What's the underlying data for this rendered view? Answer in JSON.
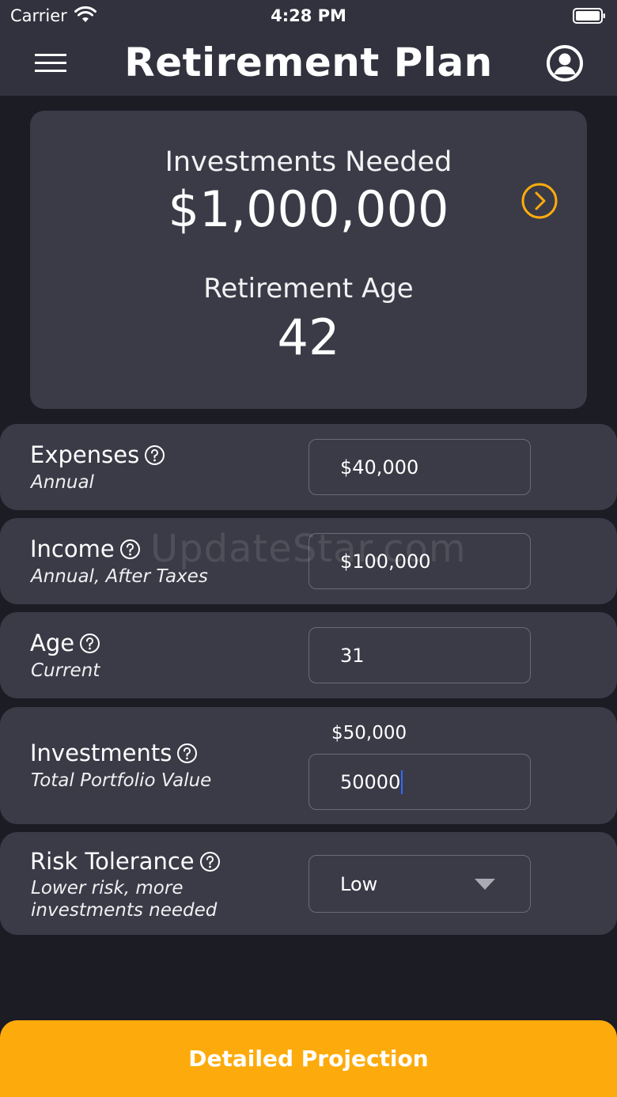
{
  "status_bar": {
    "carrier": "Carrier",
    "time": "4:28 PM"
  },
  "header": {
    "title": "Retirement Plan"
  },
  "summary": {
    "investments_label": "Investments Needed",
    "investments_value": "$1,000,000",
    "age_label": "Retirement Age",
    "age_value": "42"
  },
  "rows": {
    "expenses": {
      "title": "Expenses",
      "subtitle": "Annual",
      "value": "$40,000"
    },
    "income": {
      "title": "Income",
      "subtitle": "Annual, After Taxes",
      "value": "$100,000"
    },
    "age": {
      "title": "Age",
      "subtitle": "Current",
      "value": "31"
    },
    "investments": {
      "title": "Investments",
      "subtitle": "Total Portfolio Value",
      "formatted": "$50,000",
      "value": "50000"
    },
    "risk": {
      "title": "Risk Tolerance",
      "subtitle_line1": "Lower risk, more",
      "subtitle_line2": "investments needed",
      "value": "Low"
    }
  },
  "watermark": "UpdateStar.com",
  "cta": {
    "label": "Detailed Projection"
  },
  "colors": {
    "accent": "#fdab0c",
    "card": "#3a3b47",
    "background": "#1b1c24",
    "header": "#31323d"
  },
  "icons": [
    "wifi-icon",
    "battery-icon",
    "menu-icon",
    "profile-icon",
    "arrow-right-circle-icon",
    "help-icon",
    "dropdown-arrow-icon"
  ]
}
